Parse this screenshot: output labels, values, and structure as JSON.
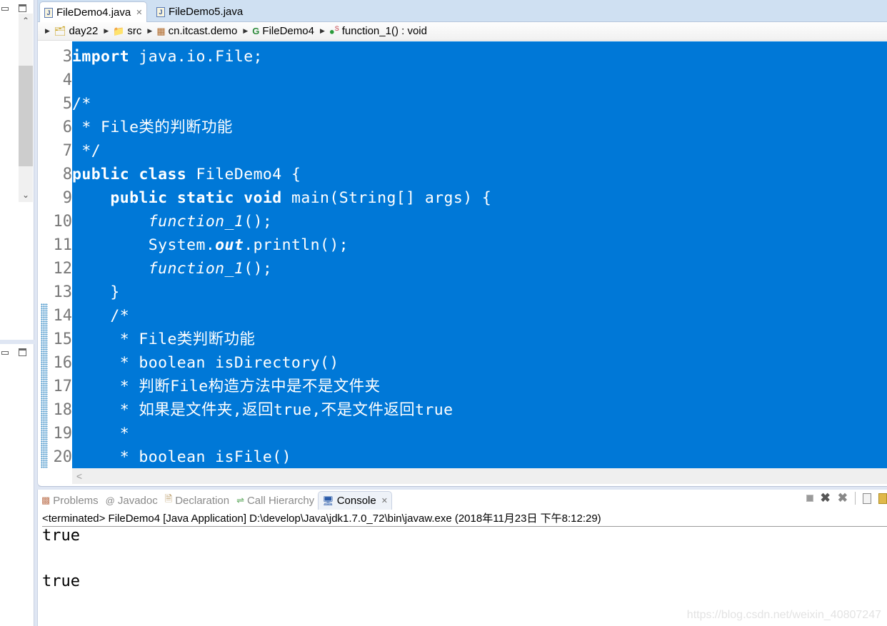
{
  "editor": {
    "tabs": [
      {
        "label": "FileDemo4.java",
        "active": true,
        "closable": true
      },
      {
        "label": "FileDemo5.java",
        "active": false,
        "closable": false
      }
    ],
    "breadcrumb": [
      {
        "label": "day22",
        "icon": "project-folder-icon"
      },
      {
        "label": "src",
        "icon": "source-folder-icon"
      },
      {
        "label": "cn.itcast.demo",
        "icon": "package-icon"
      },
      {
        "label": "FileDemo4",
        "icon": "class-icon"
      },
      {
        "label": "function_1() : void",
        "icon": "static-method-icon"
      }
    ],
    "line_numbers": [
      "3",
      "4",
      "5",
      "6",
      "7",
      "8",
      "9",
      "10",
      "11",
      "12",
      "13",
      "14",
      "15",
      "16",
      "17",
      "18",
      "19",
      "20"
    ],
    "lines": [
      [
        {
          "t": "import",
          "s": "kw"
        },
        {
          "t": " java.io.File;",
          "s": ""
        }
      ],
      [],
      [
        {
          "t": "/*",
          "s": ""
        }
      ],
      [
        {
          "t": " * File类的判断功能",
          "s": ""
        }
      ],
      [
        {
          "t": " */",
          "s": ""
        }
      ],
      [
        {
          "t": "public",
          "s": "kw"
        },
        {
          "t": " ",
          "s": ""
        },
        {
          "t": "class",
          "s": "kw"
        },
        {
          "t": " FileDemo4 {",
          "s": ""
        }
      ],
      [
        {
          "t": "    ",
          "s": ""
        },
        {
          "t": "public",
          "s": "kw"
        },
        {
          "t": " ",
          "s": ""
        },
        {
          "t": "static",
          "s": "kw"
        },
        {
          "t": " ",
          "s": ""
        },
        {
          "t": "void",
          "s": "kw"
        },
        {
          "t": " main(String[] args) {",
          "s": ""
        }
      ],
      [
        {
          "t": "        ",
          "s": ""
        },
        {
          "t": "function_1",
          "s": "it"
        },
        {
          "t": "();",
          "s": ""
        }
      ],
      [
        {
          "t": "        System.",
          "s": ""
        },
        {
          "t": "out",
          "s": "bi"
        },
        {
          "t": ".println();",
          "s": ""
        }
      ],
      [
        {
          "t": "        ",
          "s": ""
        },
        {
          "t": "function_1",
          "s": "it"
        },
        {
          "t": "();",
          "s": ""
        }
      ],
      [
        {
          "t": "    }",
          "s": ""
        }
      ],
      [
        {
          "t": "    /*",
          "s": ""
        }
      ],
      [
        {
          "t": "     * File类判断功能",
          "s": ""
        }
      ],
      [
        {
          "t": "     * boolean isDirectory()",
          "s": ""
        }
      ],
      [
        {
          "t": "     * 判断File构造方法中是不是文件夹",
          "s": ""
        }
      ],
      [
        {
          "t": "     * 如果是文件夹,返回true,不是文件返回true",
          "s": ""
        }
      ],
      [
        {
          "t": "     *",
          "s": ""
        }
      ],
      [
        {
          "t": "     * boolean isFile()",
          "s": ""
        }
      ]
    ]
  },
  "console_view": {
    "tabs": [
      {
        "label": "Problems",
        "icon": "problems-icon",
        "active": false
      },
      {
        "label": "Javadoc",
        "icon": "javadoc-icon",
        "active": false
      },
      {
        "label": "Declaration",
        "icon": "declaration-icon",
        "active": false
      },
      {
        "label": "Call Hierarchy",
        "icon": "call-hierarchy-icon",
        "active": false
      },
      {
        "label": "Console",
        "icon": "console-icon",
        "active": true
      }
    ],
    "status": "<terminated> FileDemo4 [Java Application] D:\\develop\\Java\\jdk1.7.0_72\\bin\\javaw.exe (2018年11月23日 下午8:12:29)",
    "output": [
      "true",
      "",
      "true"
    ]
  },
  "watermark": "https://blog.csdn.net/weixin_40807247"
}
